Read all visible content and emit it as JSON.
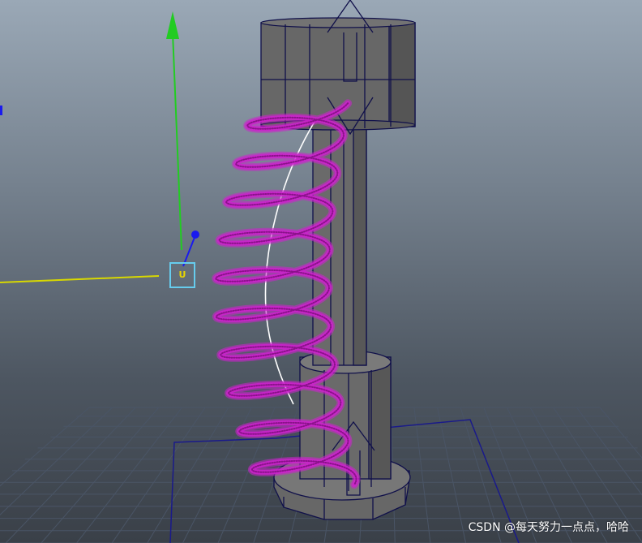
{
  "viewport": {
    "colors": {
      "background_top": "#9aa8b6",
      "background_bottom": "#3a4048",
      "grid": "#4a5566",
      "grid_border": "#1a1a8a",
      "mesh_fill": "#6b6b6b",
      "mesh_dark": "#555555",
      "wire": "#10104a",
      "spring": "#cc22cc",
      "curve": "#ffffff",
      "axis_y": "#22cc22",
      "axis_x": "#d8d800",
      "axis_z": "#1a1aee",
      "locator": "#66ccee"
    },
    "objects": {
      "top_cap": "cylinder",
      "shaft": "cylinder",
      "bottom_cylinder": "cylinder",
      "base": "octagonal-cylinder",
      "spring": "helix",
      "guide_curve": "curve"
    },
    "handle_label": "U"
  },
  "watermark": "CSDN @每天努力一点点，哈哈"
}
